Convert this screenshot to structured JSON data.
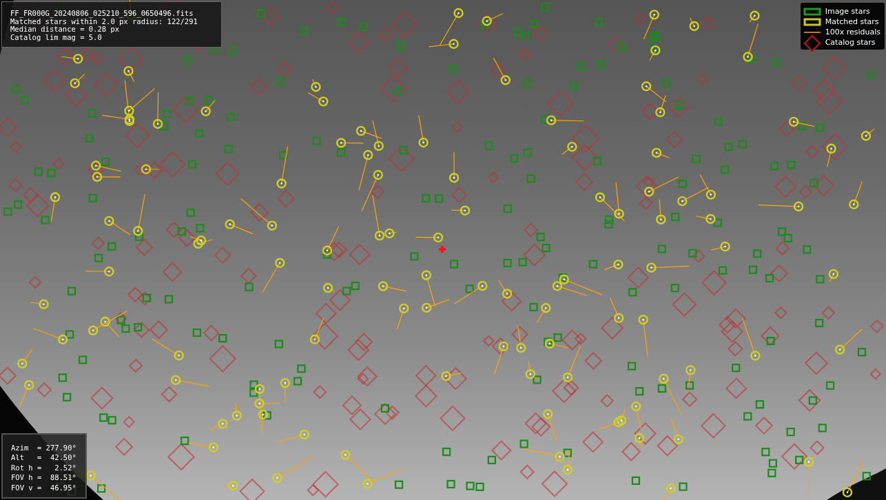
{
  "info": {
    "lines": [
      "FF_FR000G_20240806_025210_596_0650496.fits",
      "Matched stars within 2.0 px radius: 122/291",
      "Median distance = 0.28 px",
      "Catalog lim mag = 5.0"
    ]
  },
  "legend": [
    {
      "kind": "image",
      "label": "Image stars"
    },
    {
      "kind": "matched",
      "label": "Matched stars"
    },
    {
      "kind": "residual",
      "label": "100x residuals"
    },
    {
      "kind": "catalog",
      "label": "Catalog stars"
    }
  ],
  "pointing": {
    "lines": [
      "Azim  = 277.90°",
      "Alt   =  42.50°",
      "Rot h =   2.52°",
      "FOV h =  88.51°",
      "FOV v =  46.95°"
    ]
  }
}
